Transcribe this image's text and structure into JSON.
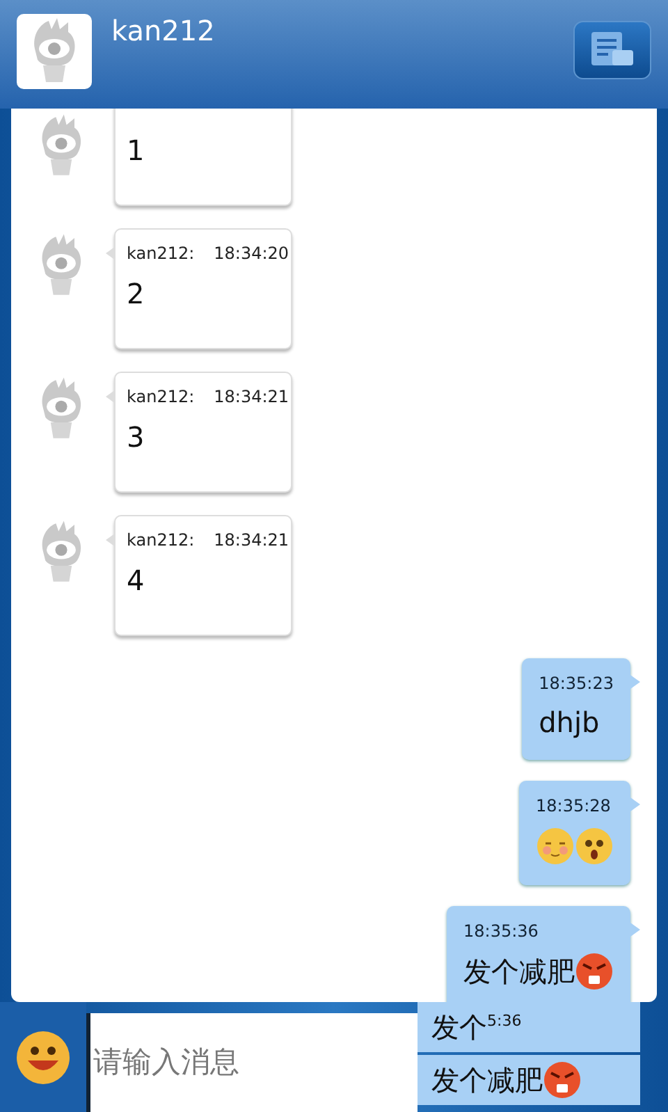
{
  "header": {
    "title": "kan212"
  },
  "messages": [
    {
      "kind": "received",
      "text": "1"
    },
    {
      "kind": "received",
      "sender": "kan212:",
      "time": "18:34:20",
      "text": "2"
    },
    {
      "kind": "received",
      "sender": "kan212:",
      "time": "18:34:21",
      "text": "3"
    },
    {
      "kind": "received",
      "sender": "kan212:",
      "time": "18:34:21",
      "text": "4"
    },
    {
      "kind": "sent",
      "time": "18:35:23",
      "text": "dhjb"
    },
    {
      "kind": "sent",
      "time": "18:35:28",
      "emojis": [
        {
          "kind": "blush"
        },
        {
          "kind": "shocked"
        }
      ]
    },
    {
      "kind": "sent",
      "time": "18:35:36",
      "text": "发个减肥",
      "emojis": [
        {
          "kind": "angry"
        }
      ]
    }
  ],
  "input": {
    "placeholder": "请输入消息"
  },
  "overlap": [
    {
      "text": "发个",
      "time": "5:36"
    },
    {
      "text": "发个减肥",
      "emojis": [
        {
          "kind": "angry"
        }
      ]
    }
  ]
}
